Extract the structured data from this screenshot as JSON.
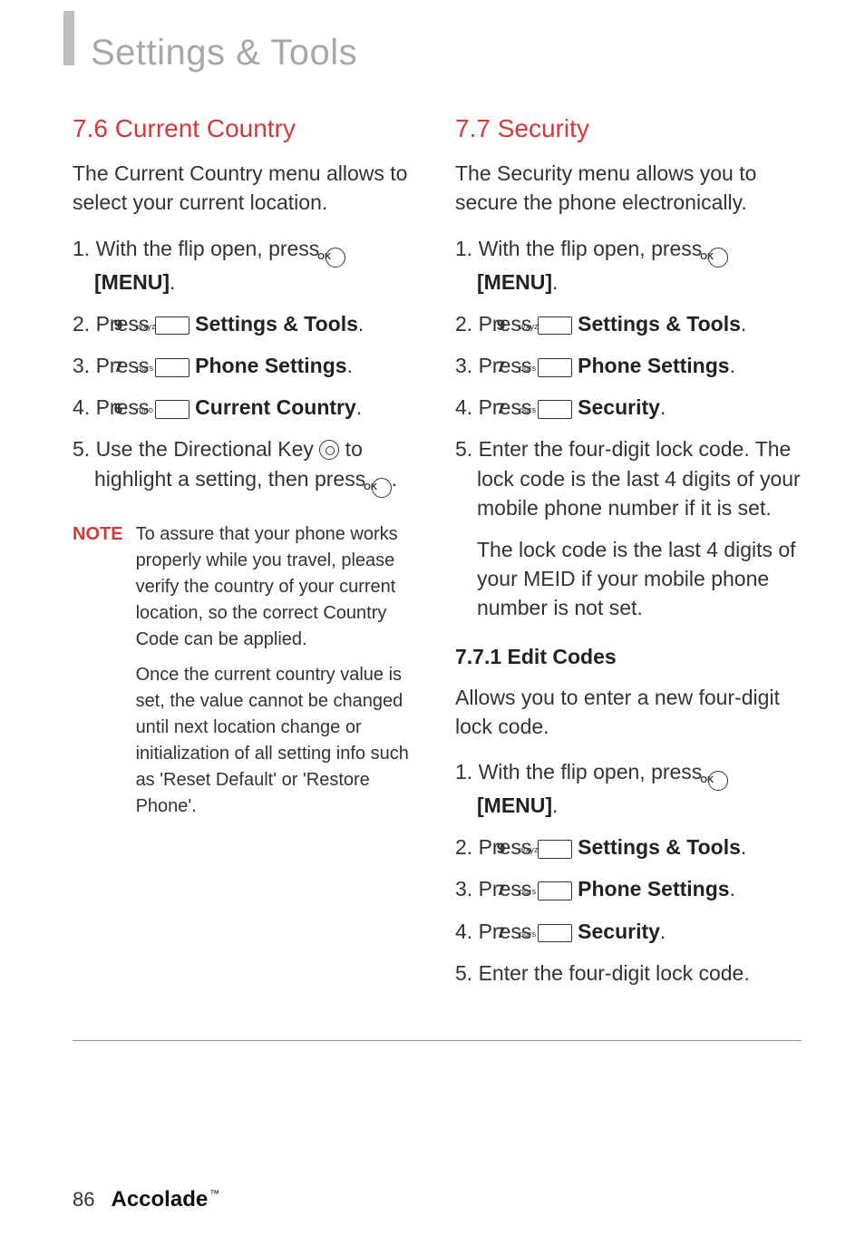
{
  "title": "Settings & Tools",
  "footer": {
    "page": "86",
    "brand": "Accolade"
  },
  "keys": {
    "ok": "OK",
    "k9": {
      "d": "9",
      "s": "wxyz"
    },
    "k7": {
      "d": "7",
      "s": "pqrs"
    },
    "k6": {
      "d": "6",
      "s": "mno"
    }
  },
  "left": {
    "heading": "7.6 Current Country",
    "intro": "The Current Country menu allows to select your current location.",
    "s1a": "1. With the flip open, press  ",
    "s1b": "[MENU]",
    "s1c": ".",
    "s2a": "2. Press ",
    "s2b": " Settings & Tools",
    "s2c": ".",
    "s3a": "3. Press ",
    "s3b": " Phone Settings",
    "s3c": ".",
    "s4a": "4. Press ",
    "s4b": " Current Country",
    "s4c": ".",
    "s5a": "5. Use the Directional Key  ",
    "s5b": " to highlight a setting, then press ",
    "s5c": ".",
    "noteLabel": "NOTE",
    "note1": "To assure that your phone works properly while you travel, please verify the country of your current location, so the correct Country Code can be applied.",
    "note2": "Once the current country value is set, the value cannot be changed until next location change or initialization of all setting info such as 'Reset Default' or 'Restore Phone'."
  },
  "right": {
    "heading": "7.7 Security",
    "intro": "The Security menu allows you to secure the phone electronically.",
    "s1a": "1. With the flip open, press  ",
    "s1b": "[MENU]",
    "s1c": ".",
    "s2a": "2. Press ",
    "s2b": " Settings & Tools",
    "s2c": ".",
    "s3a": "3. Press ",
    "s3b": " Phone Settings",
    "s3c": ".",
    "s4a": "4. Press ",
    "s4b": " Security",
    "s4c": ".",
    "s5": "5. Enter the four-digit lock code. The lock code is the last 4 digits of your mobile phone number if it is set.",
    "p1": "The lock code is the last 4 digits of your MEID if your mobile phone number is not set.",
    "sub": "7.7.1 Edit Codes",
    "subintro": "Allows you to enter a new four-digit lock code.",
    "e1a": "1. With the flip open, press  ",
    "e1b": "[MENU]",
    "e1c": ".",
    "e2a": "2. Press ",
    "e2b": " Settings & Tools",
    "e2c": ".",
    "e3a": "3. Press ",
    "e3b": " Phone Settings",
    "e3c": ".",
    "e4a": "4. Press ",
    "e4b": " Security",
    "e4c": ".",
    "e5": "5. Enter the four-digit lock code."
  }
}
